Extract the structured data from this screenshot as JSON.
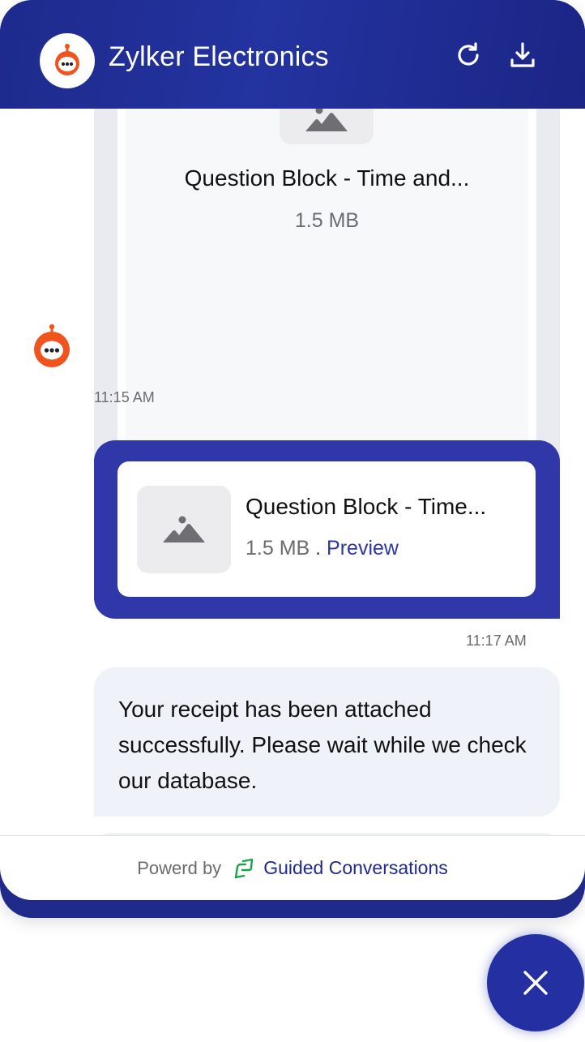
{
  "header": {
    "title": "Zylker Electronics",
    "logo_icon": "robot-icon",
    "refresh_icon": "refresh-icon",
    "download_icon": "download-icon"
  },
  "messages": {
    "bot_attachment": {
      "file_name": "Question Block - Time and...",
      "file_size": "1.5 MB",
      "time": "11:15 AM"
    },
    "user_attachment": {
      "file_name": "Question Block - Time...",
      "file_size": "1.5 MB",
      "separator": " . ",
      "preview_label": "Preview",
      "time": "11:17 AM"
    },
    "bot_text": {
      "text": "Your receipt has been attached successfully. Please wait while we check our database."
    }
  },
  "footer": {
    "powered_label": "Powerd by",
    "brand_label": "Guided Conversations"
  },
  "fab": {
    "icon": "close-icon"
  },
  "colors": {
    "brand_primary": "#1e2a8c",
    "user_bubble": "#3037a8",
    "bot_bubble": "#eff2f8",
    "avatar_orange": "#f0541e",
    "link": "#2c36a6"
  }
}
